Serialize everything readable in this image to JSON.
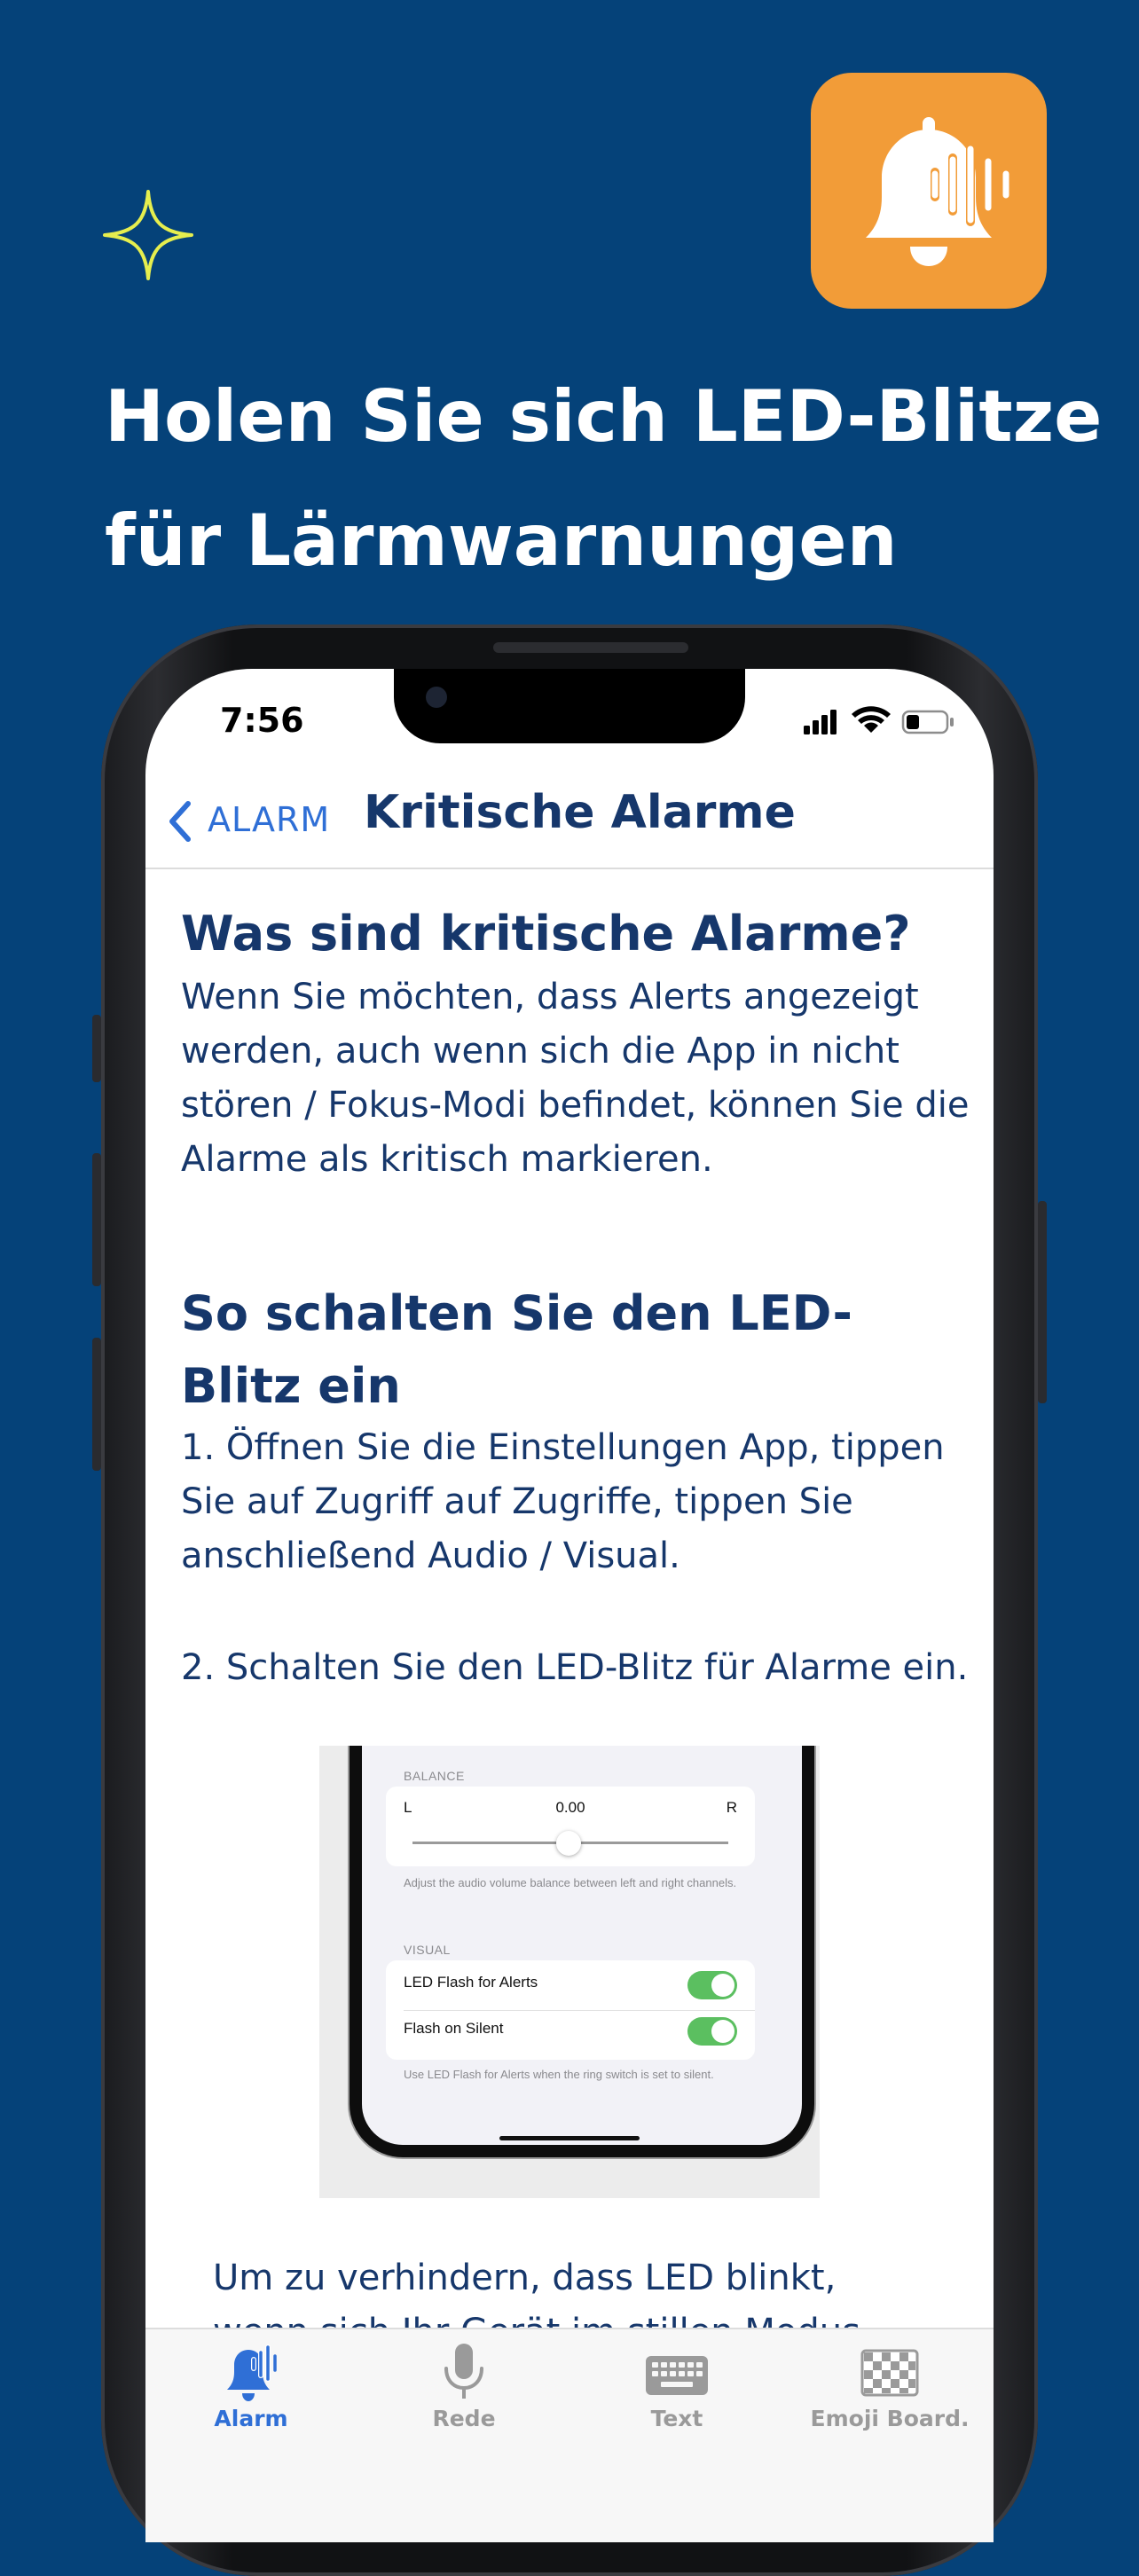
{
  "colors": {
    "background": "#054279",
    "accent_orange": "#F29C38",
    "sparkle": "#E6EE4E",
    "heading_navy": "#16376B",
    "link_blue": "#2F6FD6",
    "tab_active": "#2F6FD6",
    "tab_inactive": "#9a9a9a",
    "toggle_on": "#5BBF60"
  },
  "promo": {
    "headline_line1": "Holen Sie sich LED-Blitze",
    "headline_line2": "für Lärmwarnungen",
    "app_icon": "bell-soundwave-icon",
    "decoration": "sparkle-icon"
  },
  "status_bar": {
    "time": "7:56",
    "icons": [
      "signal-icon",
      "wifi-icon",
      "battery-icon"
    ]
  },
  "nav": {
    "back_label": "ALARM",
    "title": "Kritische Alarme"
  },
  "content": {
    "section1_heading": "Was sind kritische Alarme?",
    "section1_body": "Wenn Sie möchten, dass Alerts angezeigt werden, auch wenn sich die App in nicht stören / Fokus-Modi befindet, können Sie die Alarme als kritisch markieren.",
    "section2_heading": "So schalten Sie den LED-Blitz ein",
    "step1": "1. Öffnen Sie die Einstellungen App, tippen Sie auf Zugriff auf Zugriffe, tippen Sie anschließend Audio / Visual.",
    "step2": "2. Schalten Sie den LED-Blitz für Alarme ein.",
    "cutoff_text_line1": "Um zu verhindern, dass LED blinkt,",
    "cutoff_text_line2": "wenn sich Ihr Gerät im stillen Modus"
  },
  "embedded_settings": {
    "balance_caption": "BALANCE",
    "balance_left": "L",
    "balance_value": "0.00",
    "balance_right": "R",
    "balance_level": 0.5,
    "balance_note": "Adjust the audio volume balance between left and right channels.",
    "visual_caption": "VISUAL",
    "row1_label": "LED Flash for Alerts",
    "row1_on": true,
    "row2_label": "Flash on Silent",
    "row2_on": true,
    "visual_note": "Use LED Flash for Alerts when the ring switch is set to silent."
  },
  "tabs": [
    {
      "label": "Alarm",
      "icon": "bell-icon",
      "active": true
    },
    {
      "label": "Rede",
      "icon": "microphone-icon",
      "active": false
    },
    {
      "label": "Text",
      "icon": "keyboard-icon",
      "active": false
    },
    {
      "label": "Emoji Board.",
      "icon": "checkerboard-icon",
      "active": false
    }
  ]
}
